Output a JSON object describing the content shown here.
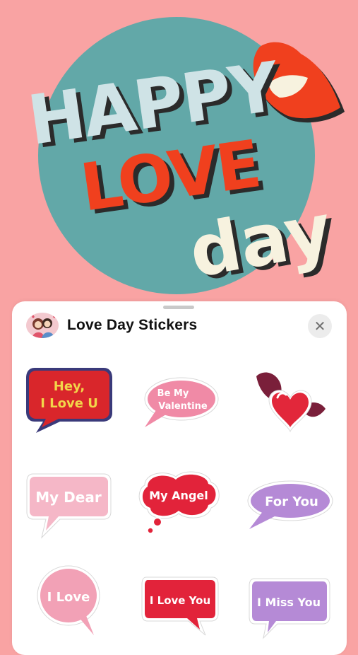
{
  "hero": {
    "line1": "HAPPY",
    "line2": "LOVE",
    "line3": "day",
    "colors": {
      "background": "#f9a3a3",
      "circle": "#62a8a8",
      "red": "#f0401e",
      "cream": "#f7f2df"
    }
  },
  "panel": {
    "title": "Love Day Stickers",
    "close_icon": "close-icon",
    "app_icon": "couple-avatar-icon"
  },
  "stickers": {
    "hey_line1": "Hey,",
    "hey_line2": "I Love U",
    "valentine_line1": "Be My",
    "valentine_line2": "Valentine",
    "my_dear": "My Dear",
    "my_angel": "My Angel",
    "for_you": "For You",
    "i_love": "I Love",
    "i_love_you": "I Love You",
    "i_miss_you": "I Miss You"
  }
}
